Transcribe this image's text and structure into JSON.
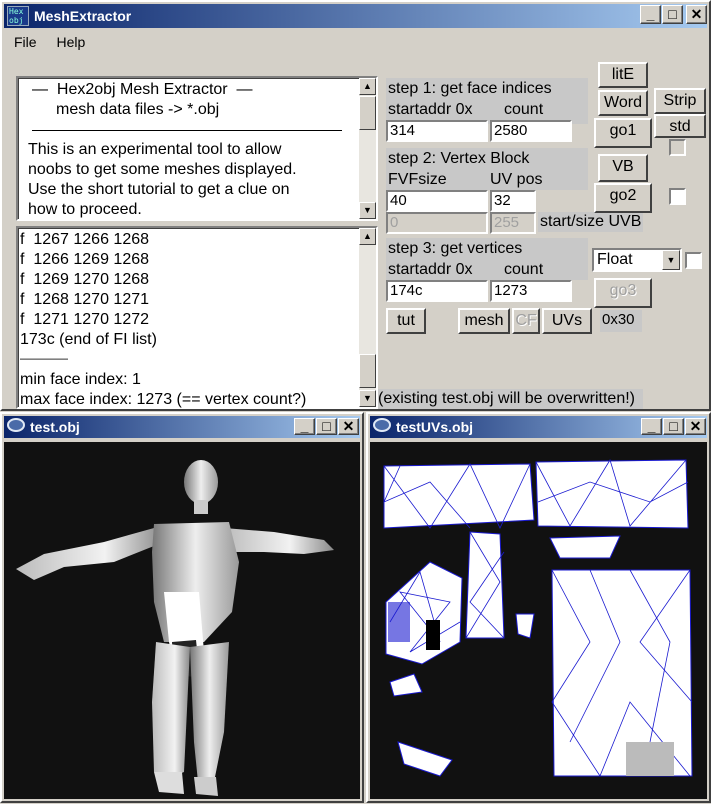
{
  "app": {
    "title": "MeshExtractor",
    "icon_text": "Hex obj"
  },
  "menu": {
    "file_label": "File",
    "help_label": "Help"
  },
  "info": {
    "lines": [
      "—  Hex2obj Mesh Extractor  —",
      "mesh data files -> *.obj",
      "This is an experimental tool to allow",
      "noobs to get some meshes displayed.",
      "Use the short tutorial to get a clue on",
      "how to proceed."
    ]
  },
  "log": {
    "lines": [
      "f  1267 1266 1268",
      "f  1266 1269 1268",
      "f  1269 1270 1268",
      "f  1268 1270 1271",
      "f  1271 1270 1272",
      "173c (end of FI list)",
      "————",
      "min face index: 1",
      "max face index: 1273 (== vertex count?)"
    ]
  },
  "step1": {
    "title": "step 1: get face indices",
    "startaddr_label": "startaddr 0x",
    "count_label": "count",
    "startaddr_value": "314",
    "count_value": "2580"
  },
  "step2": {
    "title": "step 2: Vertex Block",
    "fvf_label": "FVFsize",
    "uvpos_label": "UV pos",
    "fvf_value": "40",
    "uvpos_value": "32",
    "uvb_start_value": "0",
    "uvb_size_value": "255",
    "uvb_label": "start/size UVB"
  },
  "step3": {
    "title": "step 3: get vertices",
    "startaddr_label": "startaddr 0x",
    "count_label": "count",
    "startaddr_value": "174c",
    "count_value": "1273"
  },
  "buttons": {
    "lite": "litE",
    "word": "Word",
    "strip": "Strip",
    "std": "std",
    "go1": "go1",
    "vb": "VB",
    "go2": "go2",
    "go3": "go3",
    "tut": "tut",
    "mesh": "mesh",
    "cf": "CF",
    "uvs": "UVs"
  },
  "format_select": {
    "value": "Float"
  },
  "fvf_hex_label": "0x30",
  "overwrite_note": "(existing test.obj will be overwritten!)",
  "viewer1": {
    "title": "test.obj"
  },
  "viewer2": {
    "title": "testUVs.obj"
  },
  "window_buttons": {
    "minimize": "_",
    "maximize": "□",
    "close": "✕"
  }
}
